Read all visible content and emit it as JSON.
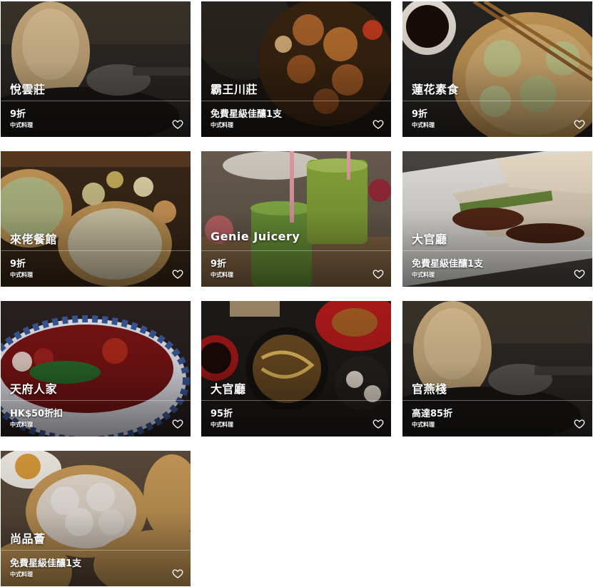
{
  "restaurants": [
    {
      "name": "悅雲莊",
      "offer": "9折",
      "cuisine": "中式料理",
      "bg": "#2a2622",
      "accent": "#c8a878",
      "icon": "heart-outline-icon"
    },
    {
      "name": "霸王川莊",
      "offer": "免費星級佳釀1支",
      "cuisine": "中式料理",
      "bg": "#1f1a16",
      "accent": "#9a5a2a",
      "icon": "heart-outline-icon"
    },
    {
      "name": "蓮花素食",
      "offer": "9折",
      "cuisine": "中式料理",
      "bg": "#2b2a26",
      "accent": "#b9a86c",
      "icon": "heart-outline-icon"
    },
    {
      "name": "來佬餐館",
      "offer": "9折",
      "cuisine": "中式料理",
      "bg": "#3a2a1c",
      "accent": "#c59a5c",
      "icon": "heart-outline-icon"
    },
    {
      "name": "Genie Juicery",
      "offer": "9折",
      "cuisine": "中式料理",
      "bg": "#4a4238",
      "accent": "#7aa03a",
      "icon": "heart-outline-icon"
    },
    {
      "name": "大官廳",
      "offer": "免費星級佳釀1支",
      "cuisine": "中式料理",
      "bg": "#5a5450",
      "accent": "#e8ddd0",
      "icon": "heart-outline-icon"
    },
    {
      "name": "天府人家",
      "offer": "HK$50折扣",
      "cuisine": "中式料理",
      "bg": "#2a1e1e",
      "accent": "#8a1a1a",
      "icon": "heart-outline-icon"
    },
    {
      "name": "大官廳",
      "offer": "95折",
      "cuisine": "中式料理",
      "bg": "#241c18",
      "accent": "#b06a2a",
      "icon": "heart-outline-icon"
    },
    {
      "name": "官燕棧",
      "offer": "高達85折",
      "cuisine": "中式料理",
      "bg": "#2a2622",
      "accent": "#c8a878",
      "icon": "heart-outline-icon"
    },
    {
      "name": "尚品薈",
      "offer": "免費星級佳釀1支",
      "cuisine": "中式料理",
      "bg": "#4a3a2a",
      "accent": "#e8c890",
      "icon": "heart-outline-icon"
    }
  ]
}
